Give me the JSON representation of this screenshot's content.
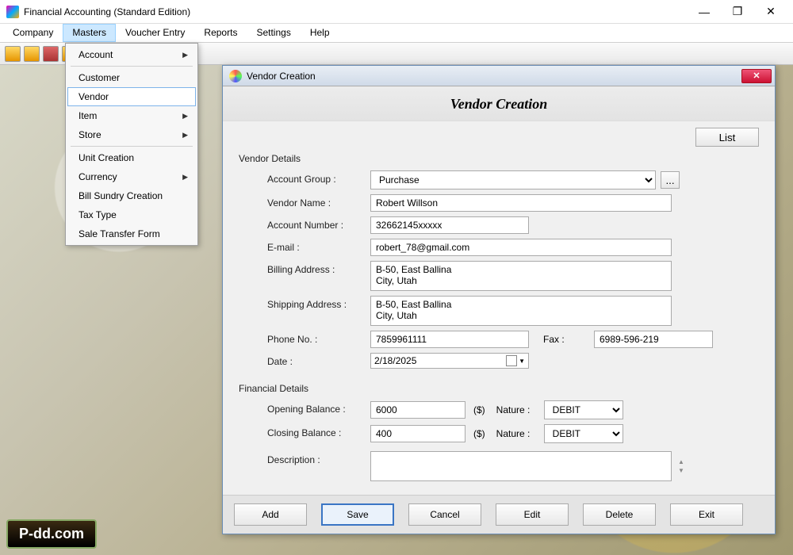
{
  "app_title": "Financial Accounting (Standard Edition)",
  "menus": [
    "Company",
    "Masters",
    "Voucher Entry",
    "Reports",
    "Settings",
    "Help"
  ],
  "open_menu_index": 1,
  "dropdown": {
    "items": [
      {
        "label": "Account",
        "submenu": true
      },
      {
        "label": "Customer"
      },
      {
        "label": "Vendor",
        "selected": true
      },
      {
        "label": "Item",
        "submenu": true
      },
      {
        "label": "Store",
        "submenu": true
      },
      {
        "sep": true
      },
      {
        "label": "Unit Creation"
      },
      {
        "label": "Currency",
        "submenu": true
      },
      {
        "label": "Bill Sundry Creation"
      },
      {
        "label": "Tax Type"
      },
      {
        "label": "Sale Transfer Form"
      }
    ]
  },
  "dialog": {
    "title": "Vendor Creation",
    "heading": "Vendor Creation",
    "list_btn": "List",
    "sections": {
      "vendor_details_label": "Vendor Details",
      "financial_details_label": "Financial Details"
    },
    "labels": {
      "account_group": "Account Group  :",
      "vendor_name": "Vendor Name  :",
      "account_number": "Account Number  :",
      "email": "E-mail  :",
      "billing_address": "Billing Address  :",
      "shipping_address": "Shipping Address  :",
      "phone": "Phone No.  :",
      "fax": "Fax  :",
      "date": "Date  :",
      "opening_balance": "Opening Balance  :",
      "closing_balance": "Closing Balance  :",
      "nature": "Nature :",
      "description": "Description  :",
      "currency_unit": "($)"
    },
    "values": {
      "account_group": "Purchase",
      "vendor_name": "Robert Willson",
      "account_number": "32662145xxxxx",
      "email": "robert_78@gmail.com",
      "billing_address": "B-50, East Ballina\nCity, Utah",
      "shipping_address": "B-50, East Ballina\nCity, Utah",
      "phone": "7859961111",
      "fax": "6989-596-219",
      "date": "2/18/2025",
      "opening_balance": "6000",
      "closing_balance": "400",
      "nature_open": "DEBIT",
      "nature_close": "DEBIT",
      "description": ""
    },
    "buttons": {
      "add": "Add",
      "save": "Save",
      "cancel": "Cancel",
      "edit": "Edit",
      "delete": "Delete",
      "exit": "Exit",
      "ellipsis": "..."
    }
  },
  "logo": "P-dd.com"
}
